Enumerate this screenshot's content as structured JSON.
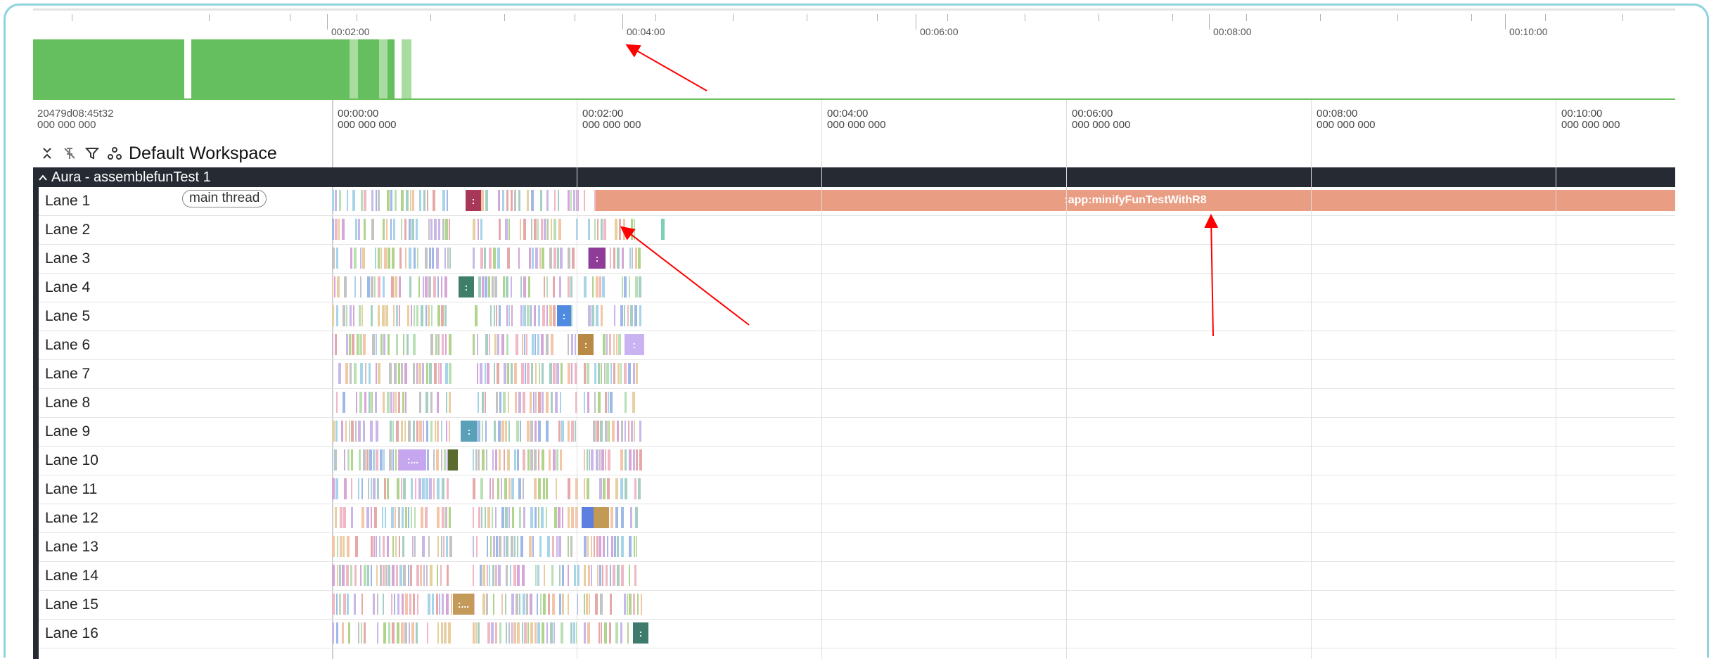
{
  "overview": {
    "ticks": [
      "00:02:00",
      "00:04:00",
      "00:06:00",
      "00:08:00",
      "00:10:00"
    ]
  },
  "axis": {
    "start_line1": "20479d08:45t32",
    "start_line2": "000 000 000",
    "labels": [
      {
        "t": "00:00:00",
        "s": "000 000 000"
      },
      {
        "t": "00:02:00",
        "s": "000 000 000"
      },
      {
        "t": "00:04:00",
        "s": "000 000 000"
      },
      {
        "t": "00:06:00",
        "s": "000 000 000"
      },
      {
        "t": "00:08:00",
        "s": "000 000 000"
      },
      {
        "t": "00:10:00",
        "s": "000 000 000"
      }
    ]
  },
  "toolbar": {
    "title": "Default Workspace",
    "icons": [
      "collapse-icon",
      "unpin-icon",
      "filter-icon",
      "workspace-icon"
    ]
  },
  "group": {
    "title": "Aura - assemblefunTest 1",
    "chevron": "^"
  },
  "lanes": [
    {
      "name": "Lane 1",
      "badge": "main thread"
    },
    {
      "name": "Lane 2"
    },
    {
      "name": "Lane 3"
    },
    {
      "name": "Lane 4"
    },
    {
      "name": "Lane 5"
    },
    {
      "name": "Lane 6"
    },
    {
      "name": "Lane 7"
    },
    {
      "name": "Lane 8"
    },
    {
      "name": "Lane 9"
    },
    {
      "name": "Lane 10"
    },
    {
      "name": "Lane 11"
    },
    {
      "name": "Lane 12"
    },
    {
      "name": "Lane 13"
    },
    {
      "name": "Lane 14"
    },
    {
      "name": "Lane 15"
    },
    {
      "name": "Lane 16"
    }
  ],
  "big_task": {
    "label": ":app:minifyFunTestWithR8",
    "color": "#e99d83"
  },
  "colors": {
    "overview_green": "#66bf5e",
    "header_dark": "#252a33",
    "arrow_red": "#ff0000"
  },
  "task_palette": [
    "#c9b7e8",
    "#a8d4ea",
    "#f0b7c4",
    "#b9e0b4",
    "#e8cfa0",
    "#9fb8e6",
    "#d6a6d8",
    "#a5cfc3",
    "#f2c6a6",
    "#c3c3c3",
    "#e5a9a9",
    "#b0d48c"
  ]
}
